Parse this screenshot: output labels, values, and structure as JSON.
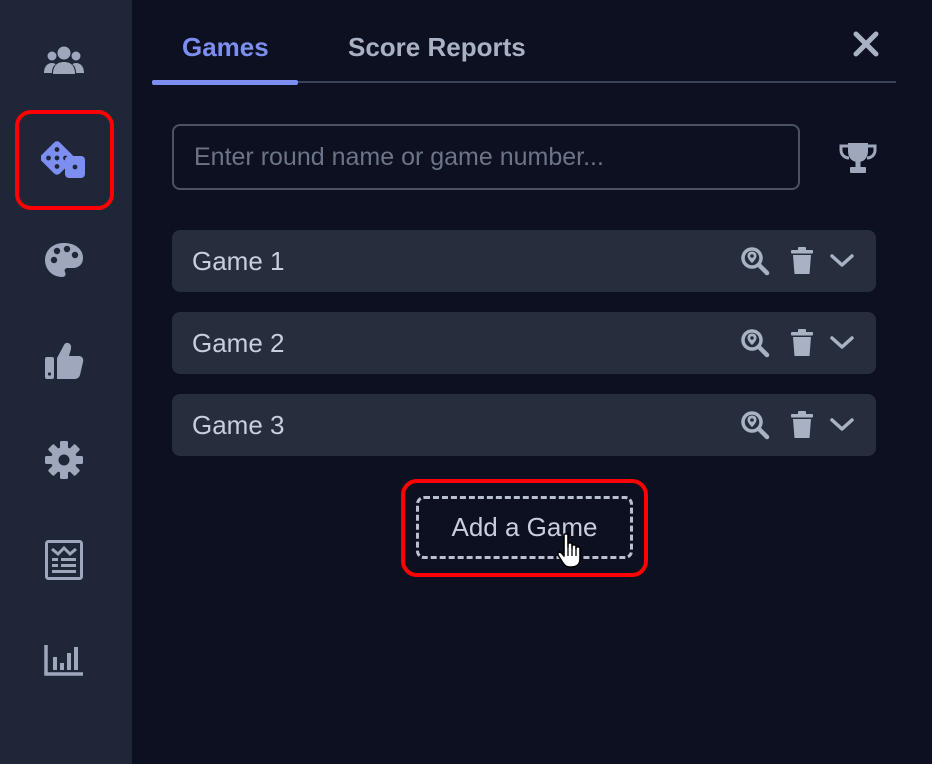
{
  "sidebar": {
    "items": [
      {
        "name": "users",
        "icon": "users-icon"
      },
      {
        "name": "games",
        "icon": "dice-icon",
        "active": true
      },
      {
        "name": "theme",
        "icon": "palette-icon"
      },
      {
        "name": "feedback",
        "icon": "thumbs-up-icon"
      },
      {
        "name": "settings",
        "icon": "gear-icon"
      },
      {
        "name": "scoreboard",
        "icon": "scoreboard-icon"
      },
      {
        "name": "stats",
        "icon": "bar-chart-icon"
      }
    ]
  },
  "tabs": {
    "games": "Games",
    "score_reports": "Score Reports",
    "active": "games"
  },
  "search": {
    "placeholder": "Enter round name or game number...",
    "value": ""
  },
  "games": {
    "items": [
      {
        "label": "Game 1"
      },
      {
        "label": "Game 2"
      },
      {
        "label": "Game 3"
      }
    ]
  },
  "add_game": {
    "label": "Add a Game"
  },
  "colors": {
    "accent": "#7c8ff0",
    "sidebar_bg": "#1f2637",
    "page_bg": "#0c1020",
    "row_bg": "#262d3d",
    "highlight": "#ff0000",
    "icon": "#9ea7bb"
  }
}
